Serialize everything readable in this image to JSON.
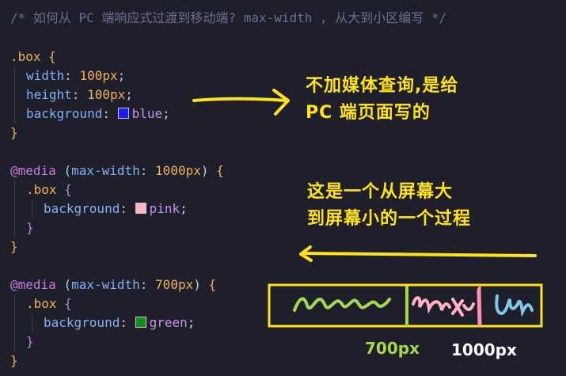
{
  "comment": "/* 如何从 PC 端响应式过渡到移动端? max-width , 从大到小区编写 */",
  "blocks": {
    "box": {
      "selector": ".box",
      "open": "{",
      "close": "}",
      "decls": [
        {
          "prop": "width",
          "value": "100px"
        },
        {
          "prop": "height",
          "value": "100px"
        },
        {
          "prop": "background",
          "value": "blue",
          "swatch": "#1a1aff"
        }
      ]
    },
    "media1": {
      "at": "@media",
      "query_prop": "max-width",
      "query_val": "1000px",
      "selector": ".box",
      "decl_prop": "background",
      "decl_val": "pink",
      "swatch": "#ffb3c7"
    },
    "media2": {
      "at": "@media",
      "query_prop": "max-width",
      "query_val": "700px",
      "selector": ".box",
      "decl_prop": "background",
      "decl_val": "green",
      "swatch": "#1a8a1a"
    }
  },
  "annotations": {
    "note1_line1": "不加媒体查询,是给",
    "note1_line2": "PC 端页面写的",
    "note2_line1": "这是一个从屏幕大",
    "note2_line2": "到屏幕小的一个过程",
    "label_700": "700px",
    "label_1000": "1000px"
  },
  "colors": {
    "annotation": "#ffe21a",
    "green_scribble": "#a6d84a",
    "pink_scribble": "#ffb3c7",
    "blue_scribble": "#7fc8e8",
    "label_700": "#a6d84a",
    "label_1000": "#ffffff"
  }
}
